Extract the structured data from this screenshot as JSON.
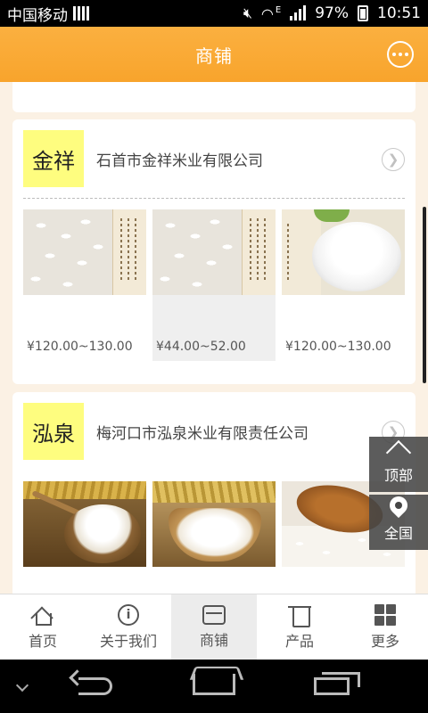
{
  "status_bar": {
    "carrier": "中国移动",
    "network": "E",
    "battery": "97%",
    "time": "10:51"
  },
  "header": {
    "title": "商铺",
    "chat_icon": "chat-bubble-icon"
  },
  "shops": [
    {
      "logo_text": "金祥",
      "name": "石首市金祥米业有限公司",
      "products": [
        {
          "image": "rice-grains-with-calligraphy",
          "price": "¥120.00~130.00"
        },
        {
          "image": "rice-grains-with-calligraphy",
          "price": "¥44.00~52.00"
        },
        {
          "image": "rice-bowl",
          "price": "¥120.00~130.00"
        }
      ]
    },
    {
      "logo_text": "泓泉",
      "name": "梅河口市泓泉米业有限责任公司",
      "products": [
        {
          "image": "rice-basket-with-wheat"
        },
        {
          "image": "rice-scoop-with-wheat"
        },
        {
          "image": "rice-grains-with-wooden-spoon"
        }
      ]
    }
  ],
  "floating": {
    "top_label": "顶部",
    "all_label": "全国"
  },
  "bottom_nav": [
    {
      "label": "首页",
      "icon": "home-icon"
    },
    {
      "label": "关于我们",
      "icon": "info-icon"
    },
    {
      "label": "商铺",
      "icon": "store-icon",
      "active": true
    },
    {
      "label": "产品",
      "icon": "shirt-icon"
    },
    {
      "label": "更多",
      "icon": "grid-icon"
    }
  ],
  "colors": {
    "header": "#f8a42c",
    "logo_bg": "#fefd7f",
    "page_bg": "#fbf1e4"
  }
}
